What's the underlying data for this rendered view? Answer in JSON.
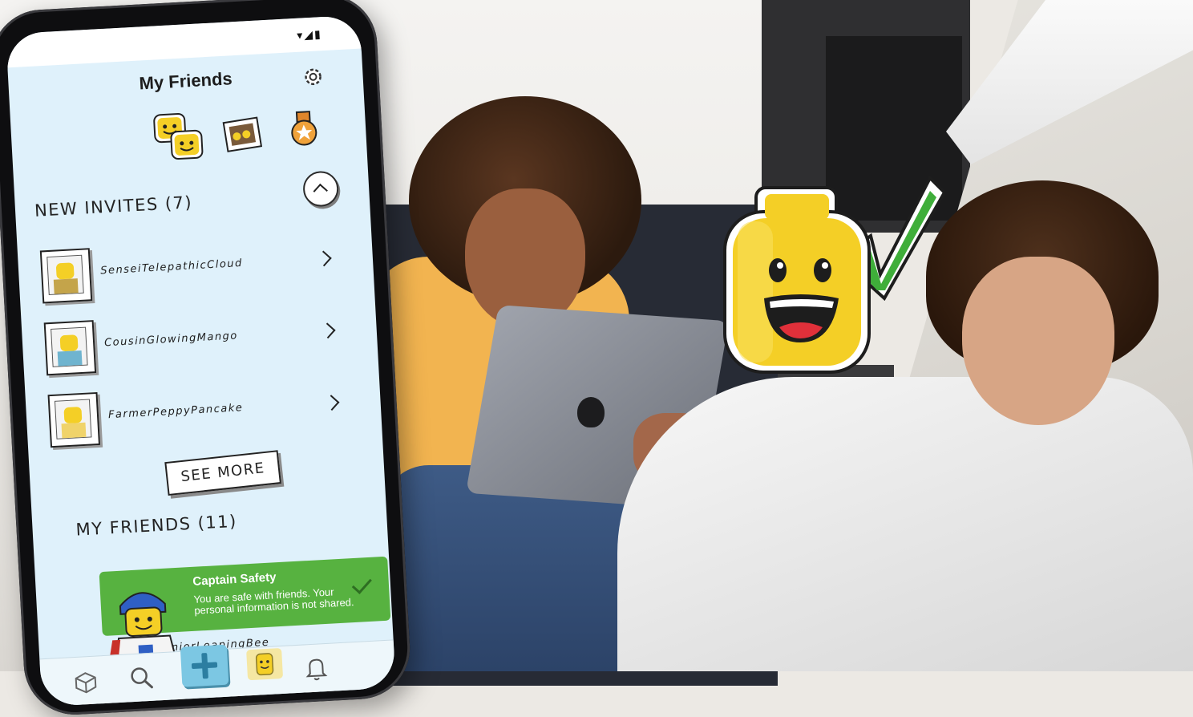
{
  "app": {
    "title": "My Friends"
  },
  "status_bar": {
    "icons": "▾◢▮"
  },
  "tabs": [
    {
      "name": "friends",
      "icon": "lego-heads-icon"
    },
    {
      "name": "photos",
      "icon": "photo-frame-icon"
    },
    {
      "name": "badges",
      "icon": "badge-icon"
    }
  ],
  "new_invites": {
    "heading": "NEW INVITES (7)",
    "items": [
      {
        "name": "SenseiTelepathicCloud",
        "figure_color": "#c4a44a"
      },
      {
        "name": "CousinGlowingMango",
        "figure_color": "#6fb4cf"
      },
      {
        "name": "FarmerPeppyPancake",
        "figure_color": "#f0d36a"
      }
    ],
    "see_more_label": "SEE MORE"
  },
  "my_friends": {
    "heading": "MY FRIENDS (11)",
    "partial_item": "JuniorLeapingBee"
  },
  "toast": {
    "title": "Captain Safety",
    "message": "You are safe with friends. Your personal information is not shared."
  },
  "nav": [
    {
      "name": "home",
      "icon": "lego-brick-icon"
    },
    {
      "name": "search",
      "icon": "search-icon"
    },
    {
      "name": "create",
      "icon": "plus-icon"
    },
    {
      "name": "friends",
      "icon": "lego-head-icon"
    },
    {
      "name": "notifications",
      "icon": "bell-icon"
    }
  ],
  "colors": {
    "screen_bg": "#dff1fb",
    "toast_green": "#57b240",
    "lego_yellow": "#f4cf26",
    "check_green": "#3fae3a"
  }
}
